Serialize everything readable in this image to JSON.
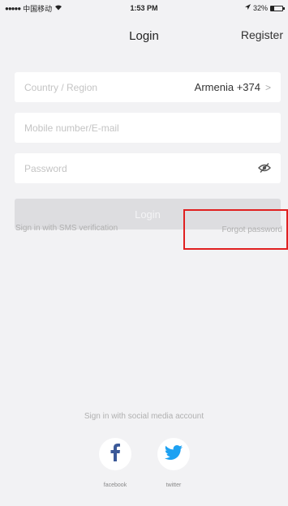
{
  "status_bar": {
    "carrier": "中国移动",
    "time": "1:53 PM",
    "battery": "32%",
    "battery_level": 0.32
  },
  "nav": {
    "title": "Login",
    "register": "Register"
  },
  "form": {
    "country_placeholder": "Country / Region",
    "country_value": "Armenia +374",
    "mobile_placeholder": "Mobile number/E-mail",
    "password_placeholder": "Password",
    "login_label": "Login"
  },
  "links": {
    "sms": "Sign in with SMS verification",
    "forgot": "Forgot password"
  },
  "social": {
    "label": "Sign in with social media account",
    "facebook": "facebook",
    "twitter": "twitter"
  },
  "colors": {
    "highlight_border": "#e02020",
    "facebook_blue": "#3b5998",
    "twitter_blue": "#1da1f2"
  }
}
